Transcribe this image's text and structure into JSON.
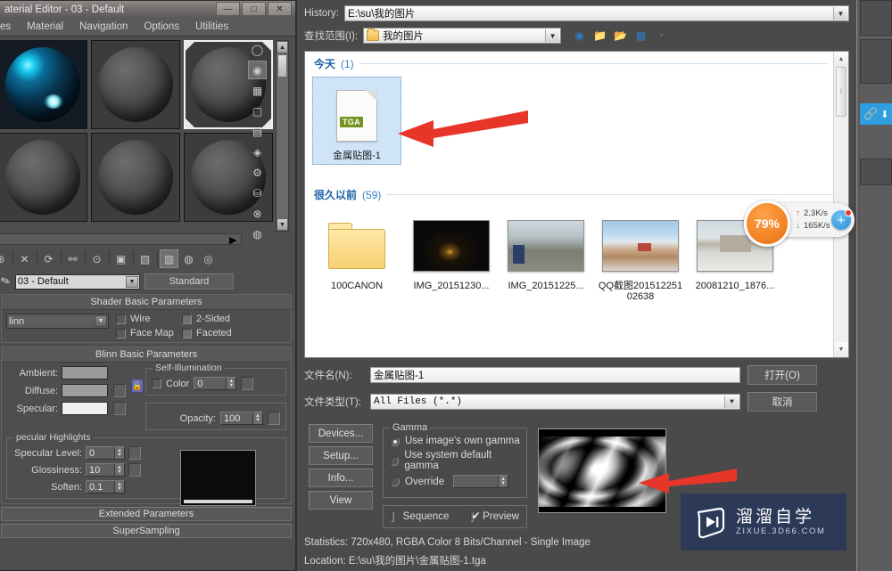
{
  "material_editor": {
    "title": "aterial Editor - 03 - Default",
    "window_buttons": [
      "—",
      "□",
      "✕"
    ],
    "menus": [
      "es",
      "Material",
      "Navigation",
      "Options",
      "Utilities"
    ],
    "slots": [
      {
        "name": "slot-1",
        "style": "blue",
        "selected": false
      },
      {
        "name": "slot-2",
        "style": "grey",
        "selected": false
      },
      {
        "name": "slot-3",
        "style": "grey",
        "selected": true
      },
      {
        "name": "slot-4",
        "style": "grey",
        "selected": false
      },
      {
        "name": "slot-5",
        "style": "grey",
        "selected": false
      },
      {
        "name": "slot-6",
        "style": "grey",
        "selected": false
      }
    ],
    "material_name": "03 - Default",
    "material_type": "Standard",
    "shader_rollout": "Shader Basic Parameters",
    "shader_type": "linn",
    "shader_checks": [
      {
        "label": "Wire",
        "checked": false
      },
      {
        "label": "2-Sided",
        "checked": false
      },
      {
        "label": "Face Map",
        "checked": false
      },
      {
        "label": "Faceted",
        "checked": false
      }
    ],
    "blinn_rollout": "Blinn Basic Parameters",
    "colors": [
      {
        "label": "Ambient:",
        "swatch": "#9a9a9a"
      },
      {
        "label": "Diffuse:",
        "swatch": "#9e9e9e"
      },
      {
        "label": "Specular:",
        "swatch": "#efefef"
      }
    ],
    "self_illum_group": "Self-Illumination",
    "self_illum_color_label": "Color",
    "self_illum_value": "0",
    "opacity_label": "Opacity:",
    "opacity_value": "100",
    "spec_highlights_group": "pecular Highlights",
    "spec_fields": [
      {
        "label": "Specular Level:",
        "value": "0"
      },
      {
        "label": "Glossiness:",
        "value": "10"
      },
      {
        "label": "Soften:",
        "value": "0.1"
      }
    ],
    "extended_rollout": "Extended Parameters",
    "supersampling_rollout": "SuperSampling",
    "toolbar_icons": [
      "get-material-icon",
      "put-to-scene-icon",
      "assign-to-selection-icon",
      "reset-map-icon",
      "make-material-copy-icon",
      "make-unique-icon",
      "put-to-library-icon",
      "material-effects-icon",
      "show-map-in-viewport-icon",
      "show-end-result-icon",
      "go-to-parent-icon",
      "go-forward-to-sibling-icon"
    ],
    "side_icons": [
      "sample-type-icon",
      "backlight-icon",
      "background-icon",
      "sample-uv-tiling-icon",
      "video-color-check-icon",
      "make-preview-icon",
      "options-icon",
      "select-by-material-icon",
      "material-id-channel-icon",
      "material-map-navigator-icon"
    ]
  },
  "dialog": {
    "history_label": "History:",
    "history_value": "E:\\su\\我的图片",
    "lookin_label": "查找范围(I):",
    "lookin_value": "我的图片",
    "nav_icons": [
      "back-icon",
      "up-one-level-icon",
      "new-folder-icon",
      "views-icon",
      "chevron-down-icon"
    ],
    "groups": [
      {
        "name": "今天",
        "count": "(1)",
        "items": [
          {
            "label": "金属贴图-1",
            "kind": "tga-file",
            "selected": true
          }
        ]
      },
      {
        "name": "很久以前",
        "count": "(59)",
        "items": [
          {
            "label": "100CANON",
            "kind": "folder",
            "selected": false
          },
          {
            "label": "IMG_20151230...",
            "kind": "photo-night",
            "selected": false
          },
          {
            "label": "IMG_20151225...",
            "kind": "photo-street",
            "selected": false
          },
          {
            "label": "QQ截图20151225102638",
            "kind": "photo-snow",
            "selected": false
          },
          {
            "label": "20081210_1876...",
            "kind": "photo-house",
            "selected": false
          }
        ]
      }
    ],
    "filename_label": "文件名(N):",
    "filename_value": "金属贴图-1",
    "filetype_label": "文件类型(T):",
    "filetype_value": "All Files (*.*)",
    "open_button": "打开(O)",
    "cancel_button": "取消",
    "side_buttons": [
      "Devices...",
      "Setup...",
      "Info...",
      "View"
    ],
    "gamma_group": "Gamma",
    "gamma_options": [
      {
        "label": "Use image's own gamma",
        "selected": true
      },
      {
        "label": "Use system default gamma",
        "selected": false
      },
      {
        "label": "Override",
        "selected": false
      }
    ],
    "gamma_override_value": "",
    "sequence_label": "Sequence",
    "sequence_checked": false,
    "preview_label": "Preview",
    "preview_checked": true,
    "statistics": "Statistics: 720x480, RGBA Color 8 Bits/Channel - Single Image",
    "location": "Location: E:\\su\\我的图片\\金属贴图-1.tga"
  },
  "download_widget": {
    "percent": "79%",
    "upload_speed": "2.3K/s",
    "download_speed": "165K/s",
    "add_button": "+"
  },
  "watermark": {
    "cn": "溜溜自学",
    "en": "ZIXUE.3D66.COM"
  },
  "annotations": {
    "arrow_color": "#e8352a",
    "arrow_file_target": "金属贴图-1",
    "arrow_preview_target": "preview-thumbnail"
  },
  "right_strip": {
    "link_icon": "link-chain-icon",
    "download_icon": "download-arrow-icon"
  }
}
